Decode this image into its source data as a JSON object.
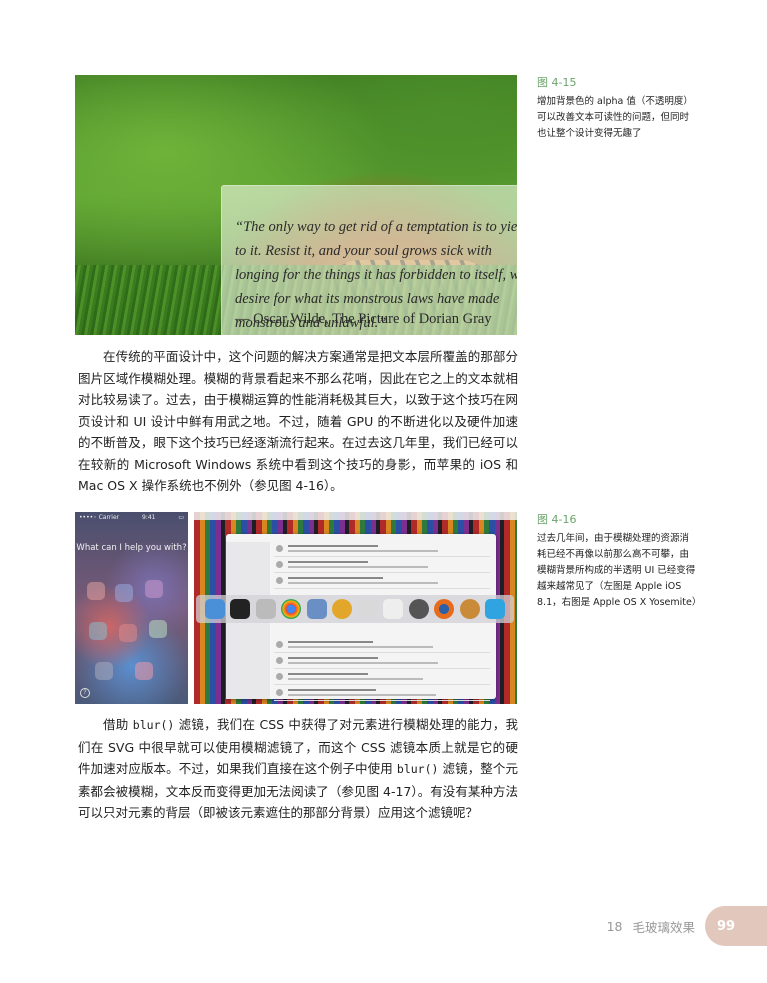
{
  "figure_4_15": {
    "quote": "“The only way to get rid of a temptation is to yield to it. Resist it, and your soul grows sick with longing for the things it has forbidden to itself, with desire for what its monstrous laws have made monstrous and unlawful.”",
    "author": "— Oscar Wilde, The Picture of Dorian Gray"
  },
  "caption_4_15": {
    "label": "图 4-15",
    "text": "增加背景色的 alpha 值（不透明度）可以改善文本可读性的问题，但同时也让整个设计变得无趣了"
  },
  "paragraph1": "在传统的平面设计中，这个问题的解决方案通常是把文本层所覆盖的那部分图片区域作模糊处理。模糊的背景看起来不那么花哨，因此在它之上的文本就相对比较易读了。过去，由于模糊运算的性能消耗极其巨大，以致于这个技巧在网页设计和 UI 设计中鲜有用武之地。不过，随着 GPU 的不断进化以及硬件加速的不断普及，眼下这个技巧已经逐渐流行起来。在过去这几年里，我们已经可以在较新的 Microsoft Windows 系统中看到这个技巧的身影，而苹果的 iOS 和 Mac OS X 操作系统也不例外（参见图 4-16）。",
  "figure_4_16": {
    "ios_status_left": "••••◦ Carrier",
    "ios_status_time": "9:41",
    "siri_prompt": "What can I help you with?",
    "help_glyph": "?"
  },
  "caption_4_16": {
    "label": "图 4-16",
    "text": "过去几年间，由于模糊处理的资源消耗已经不再像以前那么高不可攀，由模糊背景所构成的半透明 UI 已经变得越来越常见了（左图是 Apple iOS 8.1，右图是 Apple OS X Yosemite）"
  },
  "paragraph2": {
    "p1": "借助 ",
    "code1": "blur()",
    "p2": " 滤镜，我们在 CSS 中获得了对元素进行模糊处理的能力，我们在 SVG 中很早就可以使用模糊滤镜了，而这个 CSS 滤镜本质上就是它的硬件加速对应版本。不过，如果我们直接在这个例子中使用 ",
    "code2": "blur()",
    "p3": " 滤镜，整个元素都会被模糊，文本反而变得更加无法阅读了（参见图 4-17）。有没有某种方法可以只对元素的背层（即被该元素遮住的那部分背景）应用这个滤镜呢？"
  },
  "footer": {
    "chapter_no": "18",
    "chapter_title": "毛玻璃效果",
    "page_no": "99"
  }
}
